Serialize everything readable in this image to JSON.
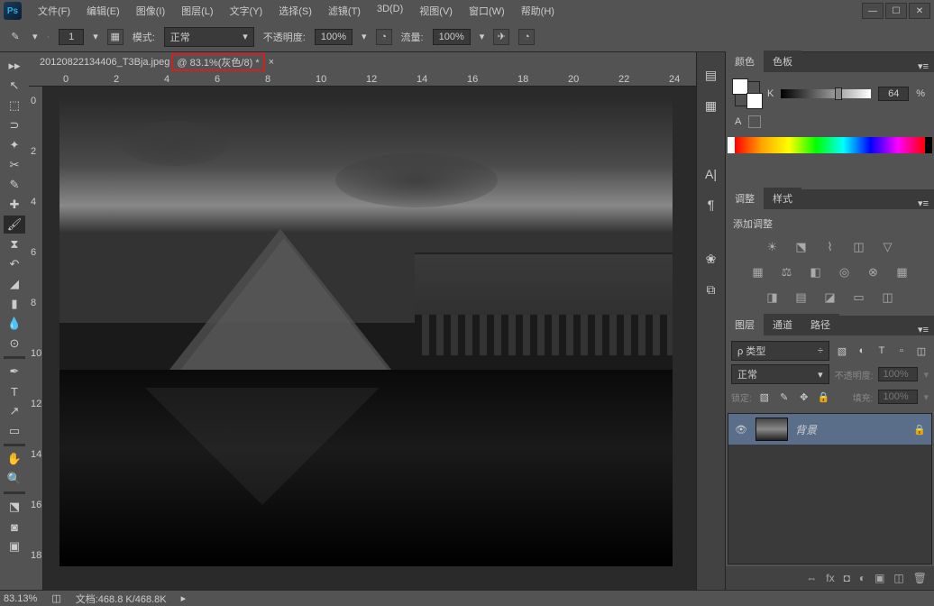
{
  "menu": [
    "文件(F)",
    "编辑(E)",
    "图像(I)",
    "图层(L)",
    "文字(Y)",
    "选择(S)",
    "滤镜(T)",
    "3D(D)",
    "视图(V)",
    "窗口(W)",
    "帮助(H)"
  ],
  "options": {
    "size_val": "1",
    "mode_label": "模式:",
    "mode_val": "正常",
    "opacity_label": "不透明度:",
    "opacity_val": "100%",
    "flow_label": "流量:",
    "flow_val": "100%"
  },
  "doctab": {
    "name": "20120822134406_T3Bja.jpeg",
    "info": "@ 83.1%(灰色/8) *",
    "close": "×"
  },
  "ruler_h": [
    0,
    2,
    4,
    6,
    8,
    10,
    12,
    14,
    16,
    18,
    20,
    22,
    24
  ],
  "ruler_v": [
    0,
    2,
    4,
    6,
    8,
    10,
    12,
    14,
    16,
    18
  ],
  "color": {
    "tab1": "颜色",
    "tab2": "色板",
    "k_label": "K",
    "k_val": "64",
    "pct": "%",
    "a_label": "A"
  },
  "adjust": {
    "tab1": "调整",
    "tab2": "样式",
    "title": "添加调整"
  },
  "layers": {
    "tab1": "图层",
    "tab2": "通道",
    "tab3": "路径",
    "kind": "ρ 类型",
    "blend": "正常",
    "opacity_label": "不透明度:",
    "opacity_val": "100%",
    "lock_label": "锁定:",
    "fill_label": "填充:",
    "fill_val": "100%",
    "layer_name": "背景"
  },
  "status": {
    "zoom": "83.13%",
    "doc_label": "文档:",
    "doc_val": "468.8 K/468.8K"
  }
}
